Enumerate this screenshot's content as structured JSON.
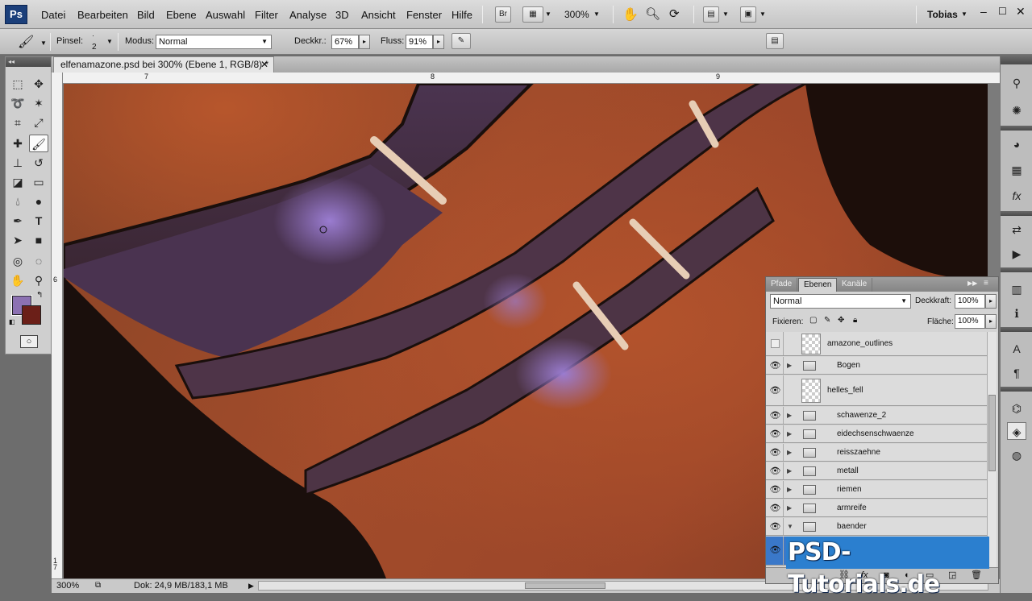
{
  "menubar": {
    "logo": "Ps",
    "items": [
      "Datei",
      "Bearbeiten",
      "Bild",
      "Ebene",
      "Auswahl",
      "Filter",
      "Analyse",
      "3D",
      "Ansicht",
      "Fenster",
      "Hilfe"
    ],
    "bridge": "Br",
    "zoom": "300%",
    "user": "Tobias"
  },
  "options": {
    "brush_label": "Pinsel:",
    "brush_size": "2",
    "mode_label": "Modus:",
    "mode_value": "Normal",
    "opacity_label": "Deckkr.:",
    "opacity_value": "67%",
    "flow_label": "Fluss:",
    "flow_value": "91%"
  },
  "document": {
    "tab_title": "elfenamazone.psd bei 300% (Ebene 1, RGB/8) *",
    "ruler_top": [
      "7",
      "8",
      "9"
    ],
    "ruler_left": [
      "6",
      "1 7"
    ],
    "zoom": "300%",
    "doc_info": "Dok: 24,9 MB/183,1 MB"
  },
  "colors": {
    "foreground": "#8c71b2",
    "background": "#6b1f18"
  },
  "layers": {
    "tabs": [
      "Pfade",
      "Ebenen",
      "Kanäle"
    ],
    "blend_mode": "Normal",
    "opacity_label": "Deckkraft:",
    "opacity_value": "100%",
    "lock_label": "Fixieren:",
    "fill_label": "Fläche:",
    "fill_value": "100%",
    "rows": [
      {
        "name": "amazone_outlines",
        "kind": "layer",
        "visible": false
      },
      {
        "name": "Bogen",
        "kind": "group",
        "visible": true
      },
      {
        "name": "helles_fell",
        "kind": "layer",
        "visible": true
      },
      {
        "name": "schawenze_2",
        "kind": "group",
        "visible": true
      },
      {
        "name": "eidechsenschwaenze",
        "kind": "group",
        "visible": true
      },
      {
        "name": "reisszaehne",
        "kind": "group",
        "visible": true
      },
      {
        "name": "metall",
        "kind": "group",
        "visible": true
      },
      {
        "name": "riemen",
        "kind": "group",
        "visible": true
      },
      {
        "name": "armreife",
        "kind": "group",
        "visible": true
      },
      {
        "name": "baender",
        "kind": "group-open",
        "visible": true
      }
    ],
    "footer_icons": [
      "link-icon",
      "fx-icon",
      "mask-icon",
      "adjustment-icon",
      "folder-icon",
      "new-layer-icon",
      "trash-icon"
    ]
  },
  "watermark": "PSD-Tutorials.de"
}
